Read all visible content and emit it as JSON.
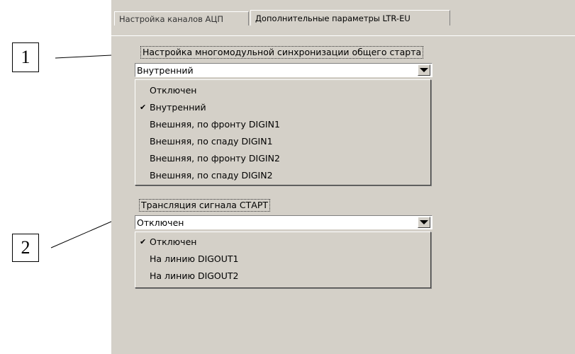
{
  "tabs": [
    {
      "label": "Настройка каналов АЦП",
      "active": false
    },
    {
      "label": "Дополнительные параметры LTR-EU",
      "active": true
    }
  ],
  "sync_group": {
    "label": "Настройка многомодульной синхронизации общего старта",
    "selected": "Внутренний",
    "options": [
      {
        "label": "Отключен",
        "checked": false
      },
      {
        "label": "Внутренний",
        "checked": true
      },
      {
        "label": "Внешняя, по фронту DIGIN1",
        "checked": false
      },
      {
        "label": "Внешняя, по спаду DIGIN1",
        "checked": false
      },
      {
        "label": "Внешняя, по фронту DIGIN2",
        "checked": false
      },
      {
        "label": "Внешняя, по спаду DIGIN2",
        "checked": false
      }
    ]
  },
  "start_group": {
    "label": "Трансляция сигнала СТАРТ",
    "selected": "Отключен",
    "options": [
      {
        "label": "Отключен",
        "checked": true
      },
      {
        "label": "На линию DIGOUT1",
        "checked": false
      },
      {
        "label": "На линию DIGOUT2",
        "checked": false
      }
    ]
  },
  "callouts": [
    "1",
    "2"
  ],
  "checkmark": "✔",
  "colors": {
    "panel": "#d4d0c8",
    "page": "#ffffff"
  }
}
